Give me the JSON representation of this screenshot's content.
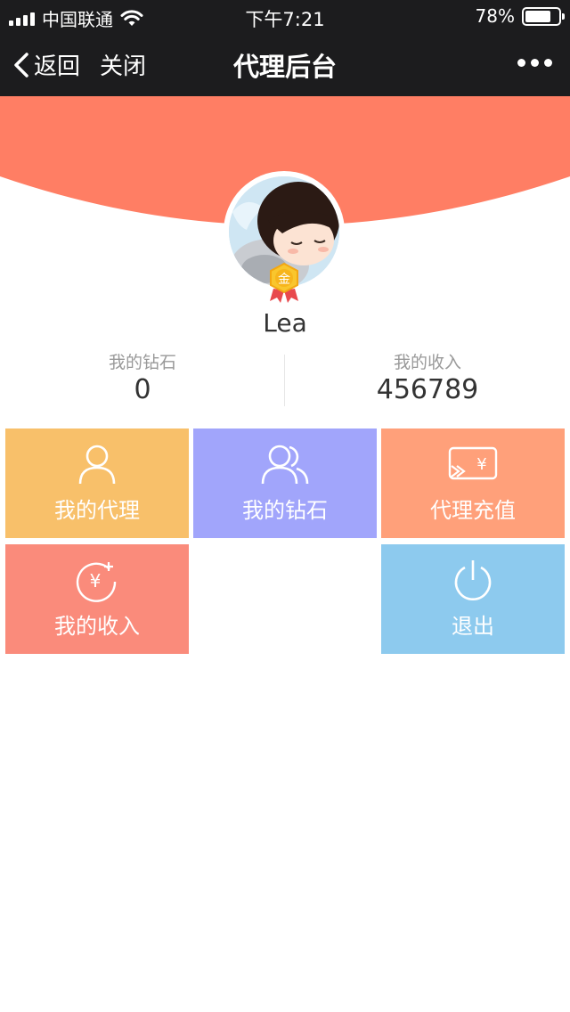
{
  "status_bar": {
    "carrier": "中国联通",
    "time": "下午7:21",
    "battery": "78%",
    "battery_level": 0.78
  },
  "nav": {
    "back_label": "返回",
    "close_label": "关闭",
    "title": "代理后台"
  },
  "profile": {
    "name": "Lea",
    "medal_text": "金"
  },
  "stats": {
    "diamonds_label": "我的钻石",
    "diamonds_value": "0",
    "income_label": "我的收入",
    "income_value": "456789"
  },
  "menu": [
    {
      "label": "我的代理",
      "icon": "person-icon",
      "color": "#f8c06a"
    },
    {
      "label": "我的钻石",
      "icon": "people-icon",
      "color": "#a1a5fb"
    },
    {
      "label": "代理充值",
      "icon": "recharge-card-icon",
      "color": "#ffa07a"
    },
    {
      "label": "我的收入",
      "icon": "yuan-plus-icon",
      "color": "#fa8b7b"
    },
    {
      "label": "退出",
      "icon": "power-icon",
      "color": "#8dcaee"
    }
  ],
  "colors": {
    "nav_bg": "#1c1c1e",
    "hero": "#ff7e64"
  }
}
